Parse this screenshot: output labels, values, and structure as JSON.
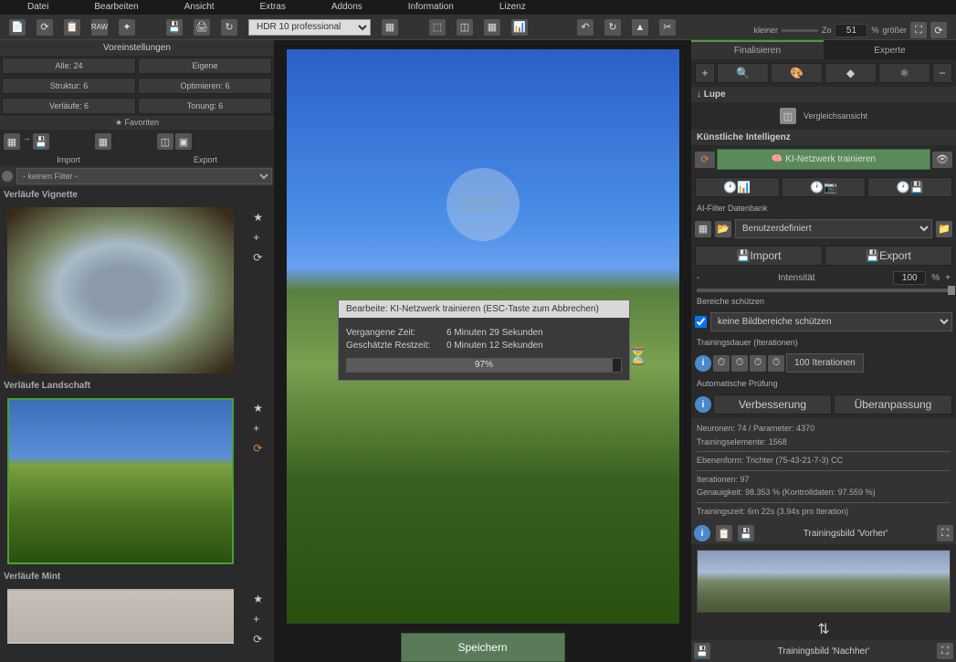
{
  "menu": [
    "Datei",
    "Bearbeiten",
    "Ansicht",
    "Extras",
    "Addons",
    "Information",
    "Lizenz"
  ],
  "toolbar": {
    "preset": "HDR 10 professional",
    "zoom_label_l": "kleiner",
    "zoom_label_r": "größer",
    "zoom_prefix": "Zo",
    "zoom_val": "51",
    "zoom_pct": "%"
  },
  "left": {
    "header": "Voreinstellungen",
    "btn_all": "Alle: 24",
    "btn_own": "Eigene",
    "btn_struct": "Struktur: 6",
    "btn_opt": "Optimieren: 6",
    "btn_grad": "Verläufe: 6",
    "btn_tone": "Tonung: 6",
    "fav": "Favoriten",
    "import": "Import",
    "export": "Export",
    "no_filter": "- keinen Filter -",
    "p1": "Verläufe Vignette",
    "p2": "Verläufe Landschaft",
    "p3": "Verläufe Mint"
  },
  "save": "Speichern",
  "right": {
    "tab1": "Finalisieren",
    "tab2": "Experte",
    "lupe": "Lupe",
    "compare": "Vergleichsansicht",
    "ki_header": "Künstliche Intelligenz",
    "ki_train": "KI-Netzwerk trainieren",
    "db_label": "AI-Filter Datenbank",
    "db_sel": "Benutzerdefiniert",
    "import": "Import",
    "export": "Export",
    "intensity": "Intensität",
    "intensity_val": "100",
    "pct": "%",
    "protect": "Bereiche schützen",
    "protect_sel": "keine Bildbereiche schützen",
    "iter_label": "Trainingsdauer (Iterationen)",
    "iter_btn": "100 Iterationen",
    "auto_check": "Automatische Prüfung",
    "improve": "Verbesserung",
    "overfit": "Überanpassung",
    "info1": "Neuronen: 74 / Parameter: 4370",
    "info2": "Trainingselemente: 1568",
    "info3": "Ebenenform: Trichter (75-43-21-7-3) CC",
    "info4": "Iterationen: 97",
    "info5": "Genauigkeit: 98.353 % (Kontrolldaten: 97.559 %)",
    "info6": "Trainingszeit: 6m 22s (3.94s pro Iteration)",
    "train_before": "Trainingsbild 'Vorher'",
    "train_after": "Trainingsbild 'Nachher'"
  },
  "dialog": {
    "title": "Bearbeite: KI-Netzwerk trainieren (ESC-Taste zum Abbrechen)",
    "elapsed_lbl": "Vergangene Zeit:",
    "elapsed_val": "6 Minuten 29 Sekunden",
    "remain_lbl": "Geschätzte Restzeit:",
    "remain_val": "0 Minuten 12 Sekunden",
    "pct": "97%"
  },
  "watermark": "Copyright by Alladesign.eu"
}
